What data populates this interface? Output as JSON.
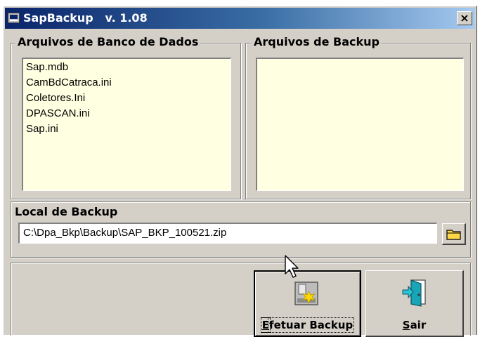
{
  "window": {
    "title": "SapBackup   v. 1.08",
    "close_symbol": "×"
  },
  "database_files": {
    "caption": "Arquivos de Banco de Dados",
    "items": [
      "Sap.mdb",
      "CamBdCatraca.ini",
      "Coletores.Ini",
      "DPASCAN.ini",
      "Sap.ini"
    ]
  },
  "backup_files": {
    "caption": "Arquivos de Backup",
    "items": []
  },
  "backup_location": {
    "caption": "Local de Backup",
    "path_value": "C:\\Dpa_Bkp\\Backup\\SAP_BKP_100521.zip",
    "browse_icon": "folder-icon"
  },
  "actions": {
    "backup_label_first": "E",
    "backup_label_rest": "fetuar Backup",
    "backup_icon": "backup-icon",
    "exit_label_first": "S",
    "exit_label_rest": "air",
    "exit_icon": "exit-door-icon"
  },
  "colors": {
    "listbox_bg": "#ffffe1",
    "titlebar_start": "#0a246a",
    "titlebar_end": "#a6caf0",
    "face": "#d4d0c8"
  }
}
